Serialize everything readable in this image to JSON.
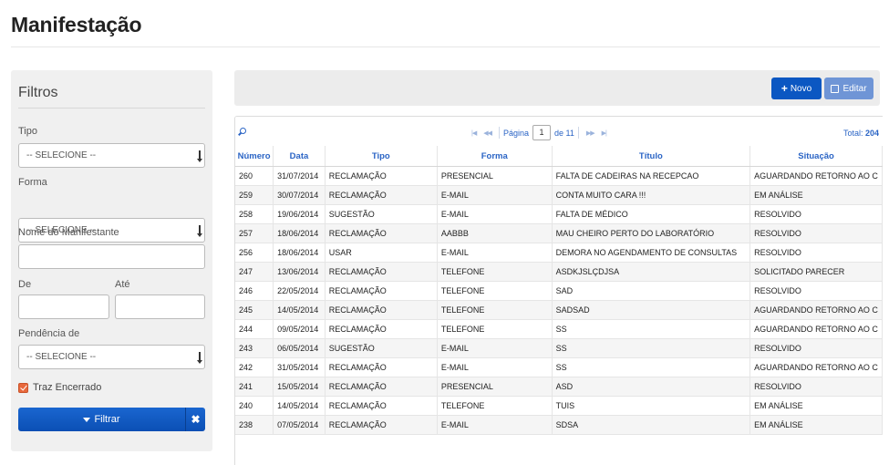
{
  "page": {
    "title": "Manifestação"
  },
  "filters": {
    "title": "Filtros",
    "tipo": {
      "label": "Tipo",
      "value": "-- SELECIONE --"
    },
    "forma": {
      "label": "Forma",
      "value": "-- SELECIONE --"
    },
    "nome": {
      "label": "Nome do Manifestante",
      "value": ""
    },
    "de": {
      "label": "De",
      "value": ""
    },
    "ate": {
      "label": "Até",
      "value": ""
    },
    "pendencia": {
      "label": "Pendência de",
      "value": "-- SELECIONE --"
    },
    "traz_encerrado": {
      "label": "Traz Encerrado",
      "checked": true
    },
    "filter_button": "Filtrar",
    "clear_button": "✖"
  },
  "toolbar": {
    "new_label": "Novo",
    "edit_label": "Editar"
  },
  "pager": {
    "page_label": "Página",
    "page": "1",
    "of_label": "de 11",
    "total_label": "Total:",
    "total": "204"
  },
  "table": {
    "headers": [
      "Número",
      "Data",
      "Tipo",
      "Forma",
      "Título",
      "Situação"
    ],
    "rows": [
      [
        "260",
        "31/07/2014",
        "RECLAMAÇÃO",
        "PRESENCIAL",
        "FALTA DE CADEIRAS NA RECEPCAO",
        "AGUARDANDO RETORNO AO C"
      ],
      [
        "259",
        "30/07/2014",
        "RECLAMAÇÃO",
        "E-MAIL",
        "CONTA MUITO CARA !!!",
        "EM ANÁLISE"
      ],
      [
        "258",
        "19/06/2014",
        "SUGESTÃO",
        "E-MAIL",
        "FALTA DE MÉDICO",
        "RESOLVIDO"
      ],
      [
        "257",
        "18/06/2014",
        "RECLAMAÇÃO",
        "AABBB",
        "MAU CHEIRO PERTO DO LABORATÓRIO",
        "RESOLVIDO"
      ],
      [
        "256",
        "18/06/2014",
        "USAR",
        "E-MAIL",
        "DEMORA NO AGENDAMENTO DE CONSULTAS",
        "RESOLVIDO"
      ],
      [
        "247",
        "13/06/2014",
        "RECLAMAÇÃO",
        "TELEFONE",
        "ASDKJSLÇDJSA",
        "SOLICITADO PARECER"
      ],
      [
        "246",
        "22/05/2014",
        "RECLAMAÇÃO",
        "TELEFONE",
        "SAD",
        "RESOLVIDO"
      ],
      [
        "245",
        "14/05/2014",
        "RECLAMAÇÃO",
        "TELEFONE",
        "SADSAD",
        "AGUARDANDO RETORNO AO C"
      ],
      [
        "244",
        "09/05/2014",
        "RECLAMAÇÃO",
        "TELEFONE",
        "SS",
        "AGUARDANDO RETORNO AO C"
      ],
      [
        "243",
        "06/05/2014",
        "SUGESTÃO",
        "E-MAIL",
        "SS",
        "RESOLVIDO"
      ],
      [
        "242",
        "31/05/2014",
        "RECLAMAÇÃO",
        "E-MAIL",
        "SS",
        "AGUARDANDO RETORNO AO C"
      ],
      [
        "241",
        "15/05/2014",
        "RECLAMAÇÃO",
        "PRESENCIAL",
        "ASD",
        "RESOLVIDO"
      ],
      [
        "240",
        "14/05/2014",
        "RECLAMAÇÃO",
        "TELEFONE",
        "TUIS",
        "EM ANÁLISE"
      ],
      [
        "238",
        "07/05/2014",
        "RECLAMAÇÃO",
        "E-MAIL",
        "SDSA",
        "EM ANÁLISE"
      ]
    ]
  },
  "colors": {
    "primary": "#0b57c2",
    "link": "#2a64c5",
    "checkbox": "#e8683c"
  }
}
